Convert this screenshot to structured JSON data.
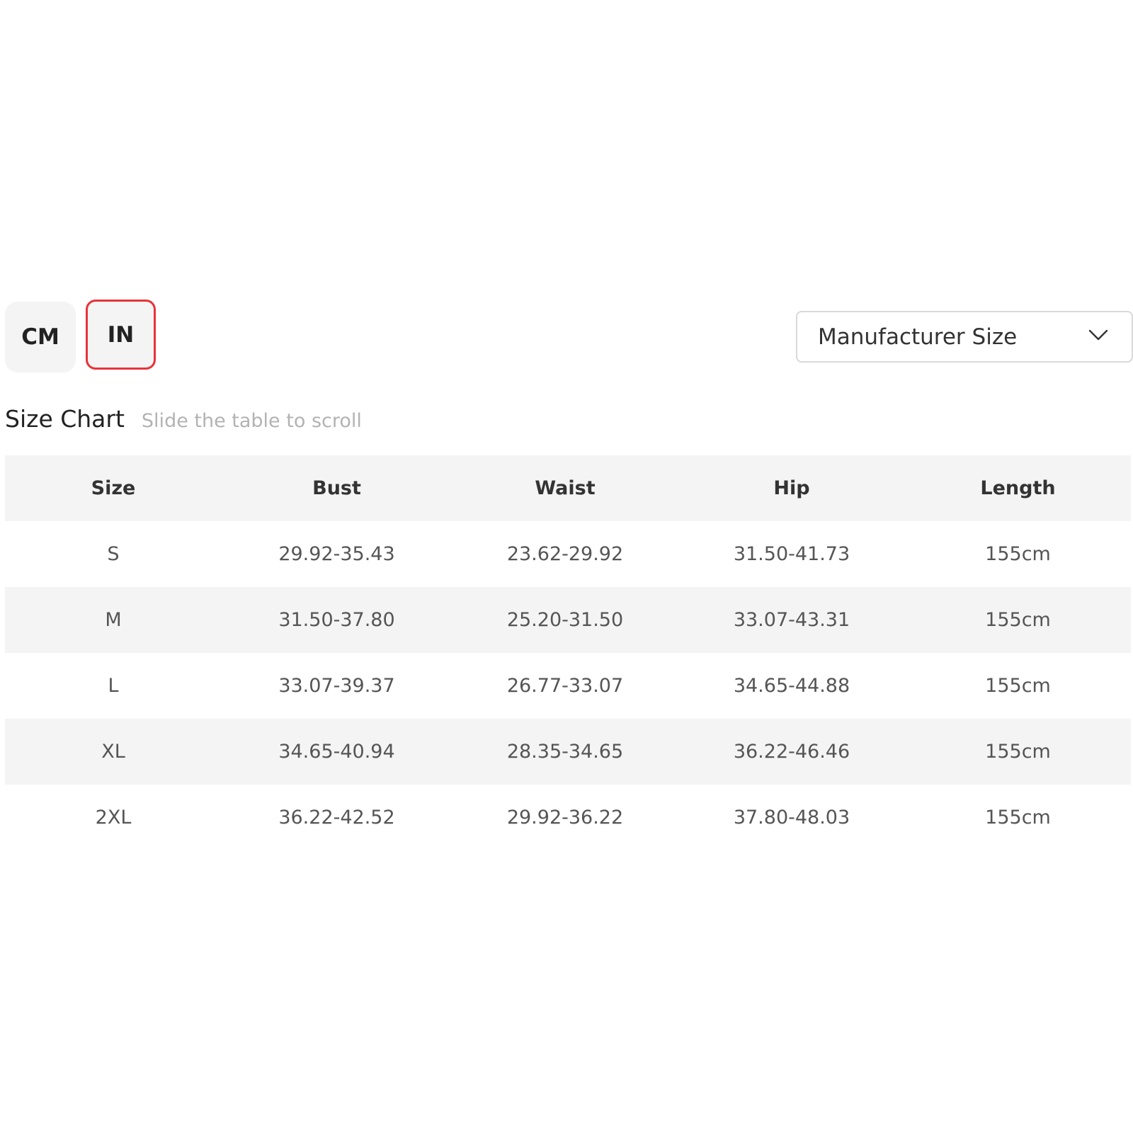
{
  "units": {
    "cm_label": "CM",
    "in_label": "IN",
    "selected": "IN"
  },
  "size_select": {
    "value": "Manufacturer Size",
    "icon": "chevron-down-icon"
  },
  "chart": {
    "title": "Size Chart",
    "hint": "Slide the table to scroll"
  },
  "table": {
    "headers": [
      "Size",
      "Bust",
      "Waist",
      "Hip",
      "Length"
    ],
    "rows": [
      [
        "S",
        "29.92-35.43",
        "23.62-29.92",
        "31.50-41.73",
        "155cm"
      ],
      [
        "M",
        "31.50-37.80",
        "25.20-31.50",
        "33.07-43.31",
        "155cm"
      ],
      [
        "L",
        "33.07-39.37",
        "26.77-33.07",
        "34.65-44.88",
        "155cm"
      ],
      [
        "XL",
        "34.65-40.94",
        "28.35-34.65",
        "36.22-46.46",
        "155cm"
      ],
      [
        "2XL",
        "36.22-42.52",
        "29.92-36.22",
        "37.80-48.03",
        "155cm"
      ]
    ]
  },
  "colors": {
    "accent_border": "#e8333a",
    "stripe": "#f4f4f4"
  }
}
